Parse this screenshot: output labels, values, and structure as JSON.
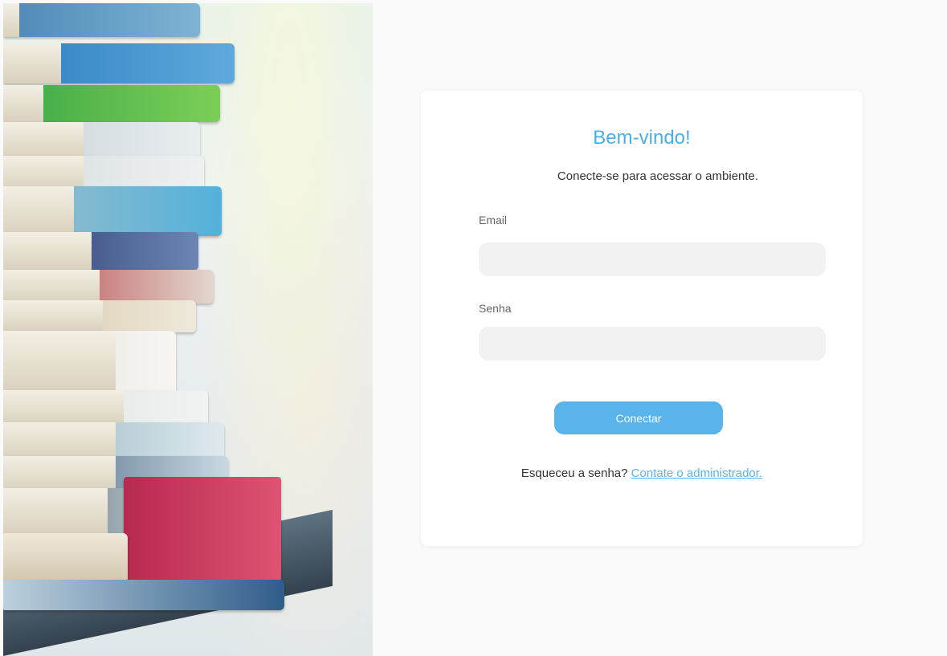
{
  "login": {
    "title": "Bem-vindo!",
    "subtitle": "Conecte-se para acessar o ambiente.",
    "email_label": "Email",
    "email_value": "",
    "password_label": "Senha",
    "password_value": "",
    "submit_label": "Conectar",
    "forgot_text": "Esqueceu a senha?",
    "forgot_link": "Contate o administrador."
  },
  "colors": {
    "accent": "#5ab3ea",
    "title": "#4dade6",
    "card_bg": "#ffffff",
    "page_bg": "#fafafa",
    "input_bg": "#f2f2f2"
  }
}
